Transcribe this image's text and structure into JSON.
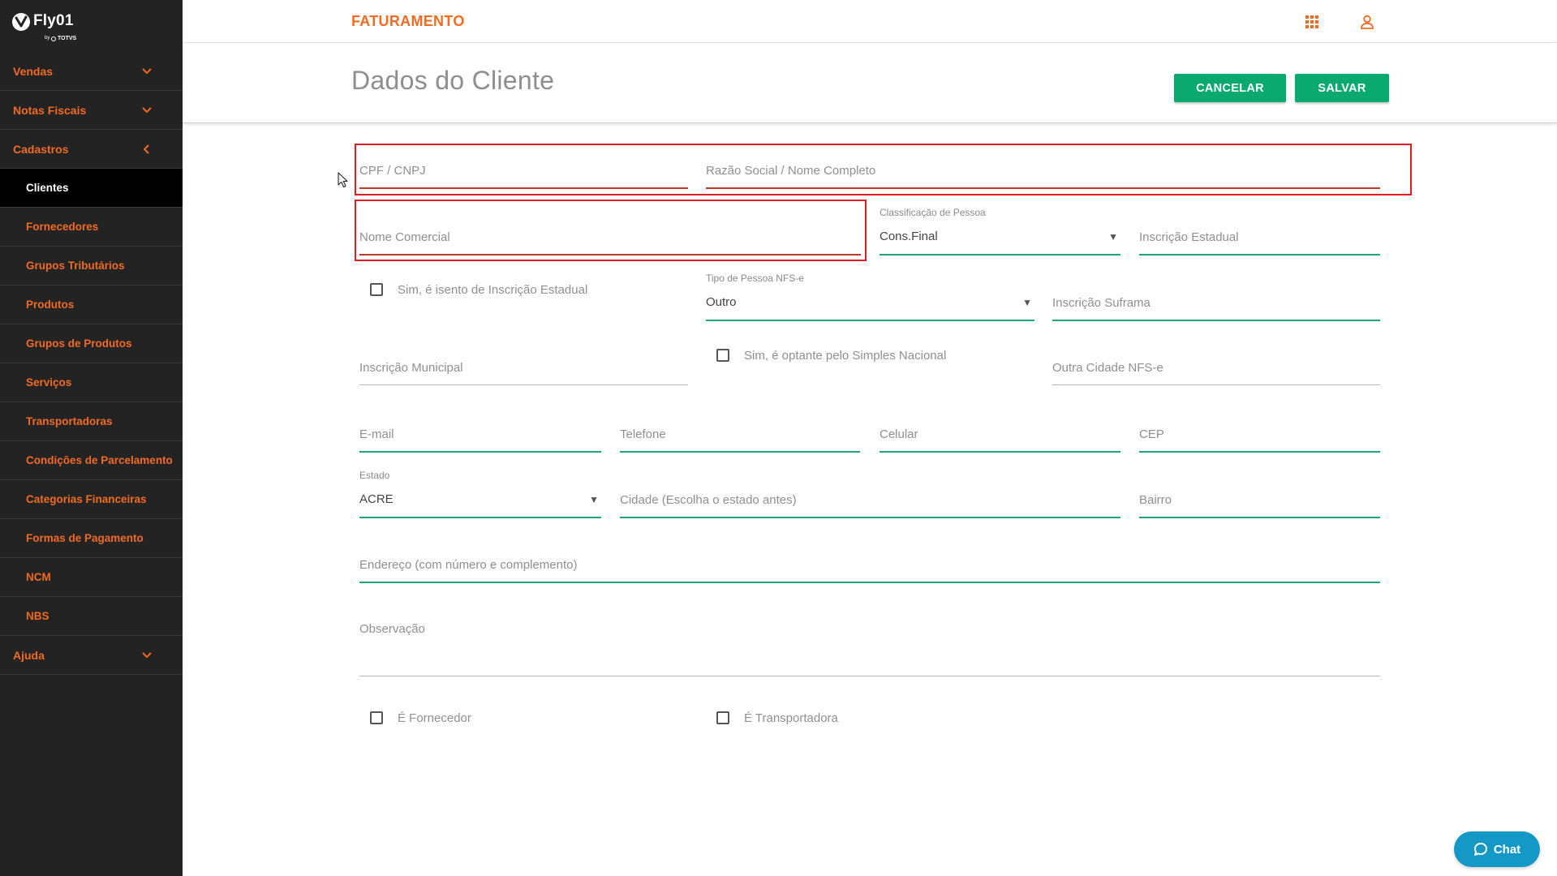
{
  "app": {
    "logo": {
      "name": "Fly01",
      "by": "by",
      "brand": "TOTVS"
    },
    "module_title": "FATURAMENTO"
  },
  "topbar": {
    "apps_icon": "grid-icon",
    "user_icon": "user-icon"
  },
  "sidebar": {
    "items": [
      {
        "label": "Vendas",
        "sub": false,
        "icon": "chevron-down-icon"
      },
      {
        "label": "Notas Fiscais",
        "sub": false,
        "icon": "chevron-down-icon"
      },
      {
        "label": "Cadastros",
        "sub": false,
        "icon": "chevron-left-icon",
        "expanded": true
      },
      {
        "label": "Clientes",
        "sub": true,
        "active": true
      },
      {
        "label": "Fornecedores",
        "sub": true
      },
      {
        "label": "Grupos Tributários",
        "sub": true
      },
      {
        "label": "Produtos",
        "sub": true
      },
      {
        "label": "Grupos de Produtos",
        "sub": true
      },
      {
        "label": "Serviços",
        "sub": true
      },
      {
        "label": "Transportadoras",
        "sub": true
      },
      {
        "label": "Condições de Parcelamento",
        "sub": true
      },
      {
        "label": "Categorias Financeiras",
        "sub": true
      },
      {
        "label": "Formas de Pagamento",
        "sub": true
      },
      {
        "label": "NCM",
        "sub": true
      },
      {
        "label": "NBS",
        "sub": true
      },
      {
        "label": "Ajuda",
        "sub": false,
        "icon": "chevron-down-icon"
      }
    ]
  },
  "page": {
    "title": "Dados do Cliente",
    "actions": {
      "cancel": "CANCELAR",
      "save": "SALVAR"
    }
  },
  "form": {
    "cpf_cnpj": {
      "placeholder": "CPF / CNPJ",
      "invalid": true
    },
    "razao_social": {
      "placeholder": "Razão Social / Nome Completo",
      "invalid": true
    },
    "nome_comercial": {
      "placeholder": "Nome Comercial",
      "invalid": true
    },
    "classificacao_pessoa": {
      "label": "Classificação de Pessoa",
      "value": "Cons.Final"
    },
    "inscricao_estadual": {
      "placeholder": "Inscrição Estadual"
    },
    "isento_ie": {
      "label": "Sim, é isento de Inscrição Estadual",
      "checked": false
    },
    "tipo_pessoa_nfse": {
      "label": "Tipo de Pessoa NFS-e",
      "value": "Outro"
    },
    "inscricao_suframa": {
      "placeholder": "Inscrição Suframa"
    },
    "inscricao_municipal": {
      "placeholder": "Inscrição Municipal"
    },
    "optante_simples": {
      "label": "Sim, é optante pelo Simples Nacional",
      "checked": false
    },
    "outra_cidade_nfse": {
      "placeholder": "Outra Cidade NFS-e"
    },
    "email": {
      "placeholder": "E-mail"
    },
    "telefone": {
      "placeholder": "Telefone"
    },
    "celular": {
      "placeholder": "Celular"
    },
    "cep": {
      "placeholder": "CEP"
    },
    "estado": {
      "label": "Estado",
      "value": "ACRE"
    },
    "cidade": {
      "placeholder": "Cidade (Escolha o estado antes)"
    },
    "bairro": {
      "placeholder": "Bairro"
    },
    "endereco": {
      "placeholder": "Endereço (com número e complemento)"
    },
    "observacao": {
      "placeholder": "Observação"
    },
    "e_fornecedor": {
      "label": "É Fornecedor",
      "checked": false
    },
    "e_transportadora": {
      "label": "É Transportadora",
      "checked": false
    }
  },
  "chat": {
    "label": "Chat",
    "icon": "chat-bubble-icon"
  },
  "colors": {
    "brand_orange": "#f26b21",
    "primary_green": "#0aa96f",
    "underline_valid": "#1fa67a",
    "underline_invalid": "#c0392b",
    "underline_neutral": "#b5b5b5",
    "sidebar_bg": "#232323",
    "highlight": "#e31b23",
    "chat": "#1499c6"
  }
}
